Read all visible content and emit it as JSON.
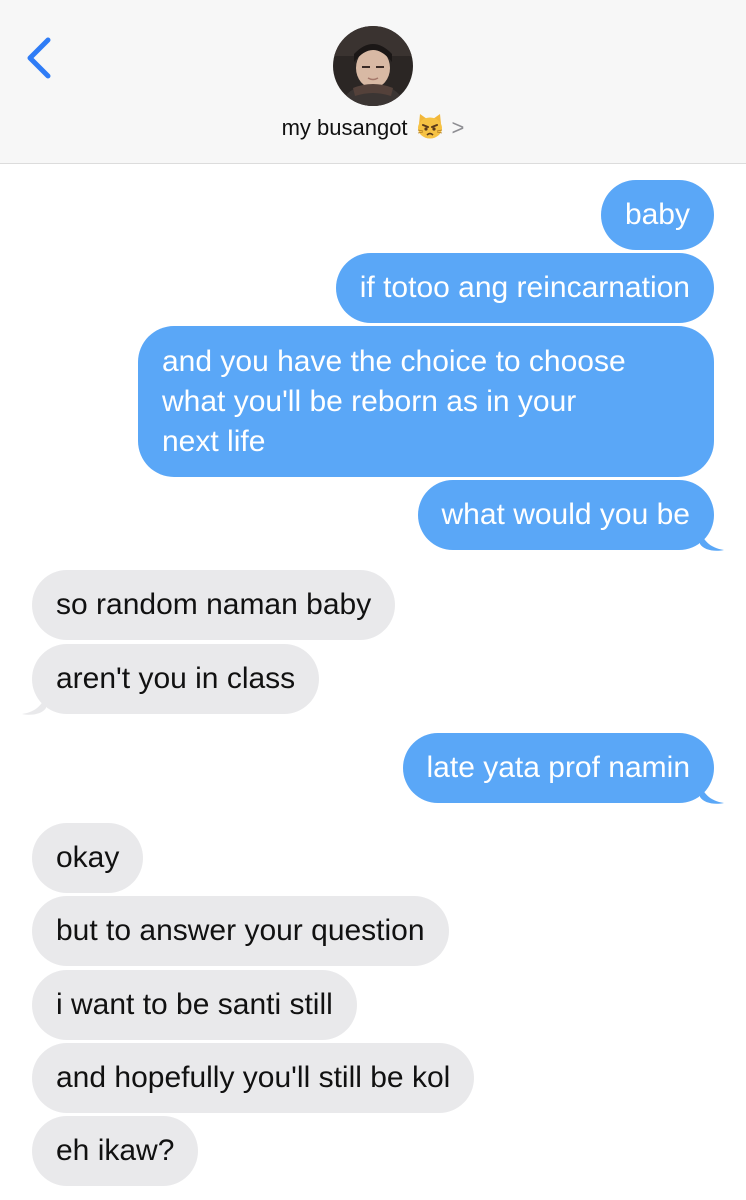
{
  "header": {
    "contact_name": "my busangot",
    "contact_emoji_icon": "pouting-cat-face-icon",
    "back_icon": "chevron-left-icon",
    "details_icon": "chevron-right-icon",
    "chevron_glyph": ">"
  },
  "colors": {
    "outgoing": "#5aa7f7",
    "incoming": "#e9e9eb",
    "accent": "#2f7cf6"
  },
  "messages": [
    {
      "from": "me",
      "text": "baby"
    },
    {
      "from": "me",
      "text": "if totoo ang reincarnation"
    },
    {
      "from": "me",
      "text": "and you have the choice to choose\nwhat you'll be reborn as in your\nnext life"
    },
    {
      "from": "me",
      "text": "what would you be"
    },
    {
      "from": "them",
      "text": "so random naman baby"
    },
    {
      "from": "them",
      "text": "aren't you in class"
    },
    {
      "from": "me",
      "text": "late yata prof namin"
    },
    {
      "from": "them",
      "text": "okay"
    },
    {
      "from": "them",
      "text": "but to answer your question"
    },
    {
      "from": "them",
      "text": "i want to be santi still"
    },
    {
      "from": "them",
      "text": "and hopefully you'll still be kol"
    },
    {
      "from": "them",
      "text": "eh ikaw?"
    }
  ]
}
